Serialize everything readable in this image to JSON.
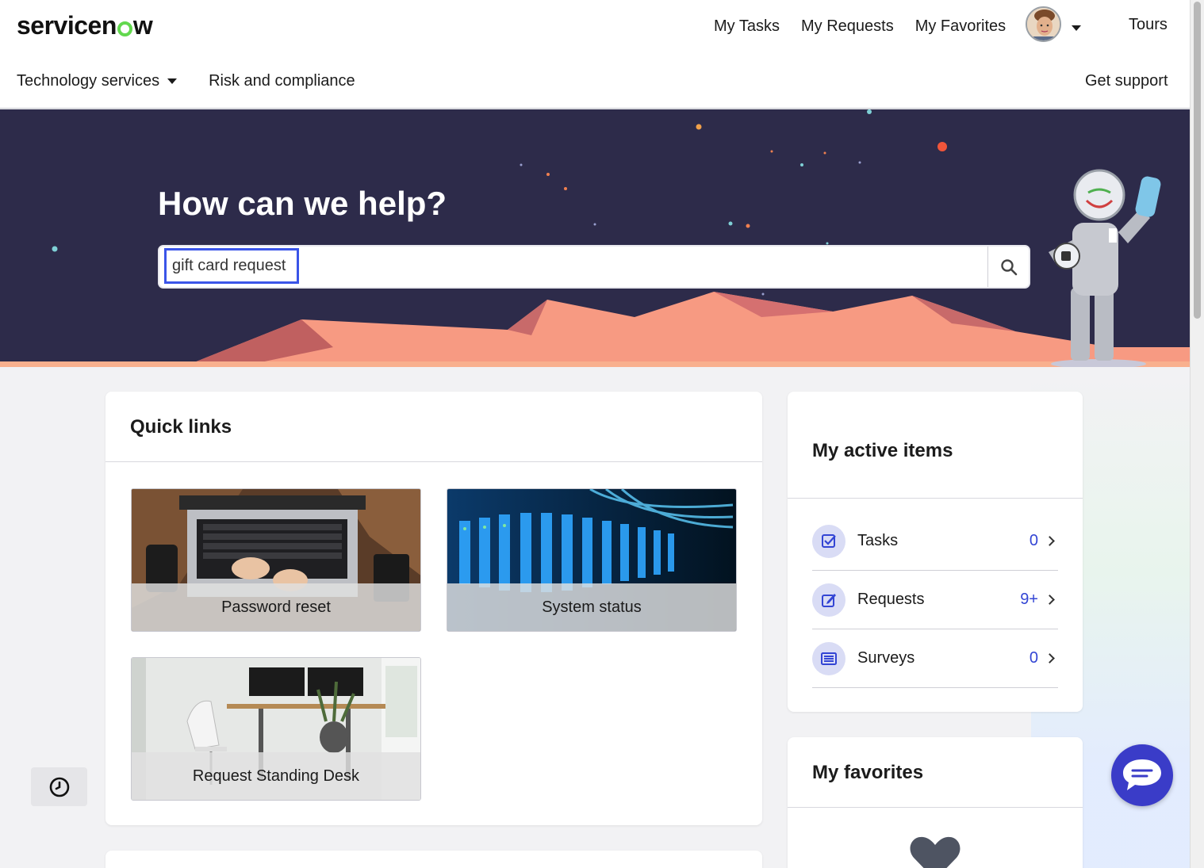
{
  "header": {
    "logo_left": "servicen",
    "logo_right": "w",
    "nav": [
      "My Tasks",
      "My Requests",
      "My Favorites"
    ],
    "tours": "Tours",
    "subnav": {
      "tech": "Technology services",
      "risk": "Risk and compliance"
    },
    "get_support": "Get support"
  },
  "hero": {
    "title": "How can we help?",
    "search_value": "gift card request"
  },
  "quick_links": {
    "title": "Quick links",
    "tiles": [
      "Password reset",
      "System status",
      "Request Standing Desk"
    ]
  },
  "active_items": {
    "title": "My active items",
    "rows": [
      {
        "label": "Tasks",
        "count": "0",
        "icon": "task-check-icon"
      },
      {
        "label": "Requests",
        "count": "9+",
        "icon": "edit-icon"
      },
      {
        "label": "Surveys",
        "count": "0",
        "icon": "list-icon"
      }
    ]
  },
  "favorites": {
    "title": "My favorites",
    "icon": "heart-icon"
  },
  "colors": {
    "accent": "#3345d4",
    "hero_bg": "#2d2b4a",
    "chat": "#3a3cc8",
    "brand_green": "#62d84e"
  }
}
